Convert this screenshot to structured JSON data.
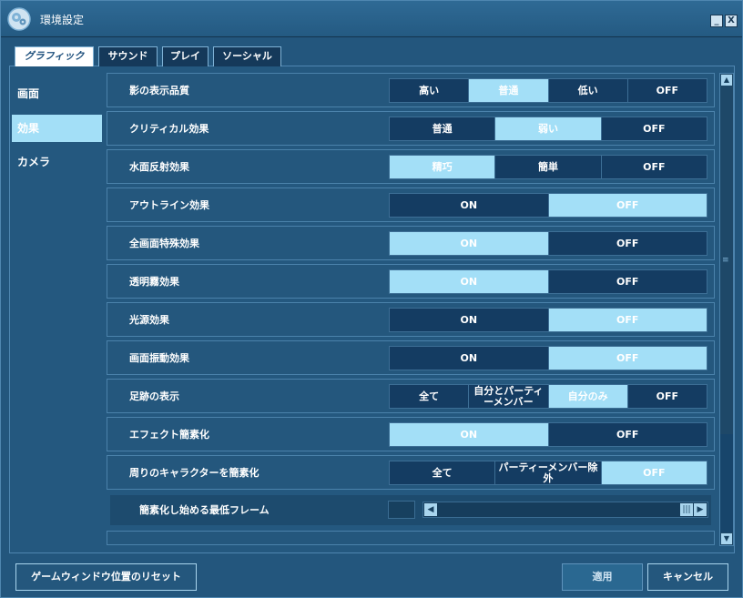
{
  "window": {
    "title": "環境設定",
    "minimize_label": "_",
    "close_label": "X"
  },
  "tabs": [
    {
      "label": "グラフィック",
      "active": true
    },
    {
      "label": "サウンド",
      "active": false
    },
    {
      "label": "プレイ",
      "active": false
    },
    {
      "label": "ソーシャル",
      "active": false
    }
  ],
  "sidebar": {
    "items": [
      {
        "label": "画面",
        "active": false
      },
      {
        "label": "効果",
        "active": true
      },
      {
        "label": "カメラ",
        "active": false
      }
    ]
  },
  "settings": [
    {
      "label": "影の表示品質",
      "options": [
        "高い",
        "普通",
        "低い",
        "OFF"
      ],
      "selected": 1
    },
    {
      "label": "クリティカル効果",
      "options": [
        "普通",
        "弱い",
        "OFF"
      ],
      "selected": 1
    },
    {
      "label": "水面反射効果",
      "options": [
        "精巧",
        "簡単",
        "OFF"
      ],
      "selected": 0
    },
    {
      "label": "アウトライン効果",
      "options": [
        "ON",
        "OFF"
      ],
      "selected": 1
    },
    {
      "label": "全画面特殊効果",
      "options": [
        "ON",
        "OFF"
      ],
      "selected": 0
    },
    {
      "label": "透明霧効果",
      "options": [
        "ON",
        "OFF"
      ],
      "selected": 0
    },
    {
      "label": "光源効果",
      "options": [
        "ON",
        "OFF"
      ],
      "selected": 1
    },
    {
      "label": "画面振動効果",
      "options": [
        "ON",
        "OFF"
      ],
      "selected": 1
    },
    {
      "label": "足跡の表示",
      "options": [
        "全て",
        "自分とパーティーメンバー",
        "自分のみ",
        "OFF"
      ],
      "selected": 2
    },
    {
      "label": "エフェクト簡素化",
      "options": [
        "ON",
        "OFF"
      ],
      "selected": 0
    },
    {
      "label": "周りのキャラクターを簡素化",
      "options": [
        "全て",
        "パーティーメンバー除外",
        "OFF"
      ],
      "selected": 2
    }
  ],
  "subsetting": {
    "label": "簡素化し始める最低フレーム",
    "slider_level": 1.0
  },
  "footer": {
    "reset_label": "ゲームウィンドウ位置のリセット",
    "apply_label": "適用",
    "cancel_label": "キャンセル"
  },
  "colors": {
    "selected": "#a3dff7",
    "unselected": "#143c62",
    "background": "#23567d"
  },
  "icons": {
    "app": "gear-cluster-icon",
    "scroll_up": "arrow-up-icon",
    "scroll_down": "arrow-down-icon",
    "slider_left": "arrow-left-icon",
    "slider_right": "arrow-right-icon"
  }
}
